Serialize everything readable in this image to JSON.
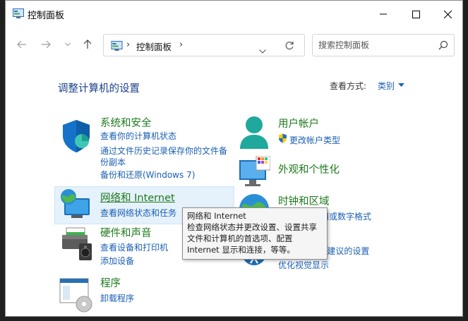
{
  "window": {
    "title": "控制面板"
  },
  "address": {
    "crumb": "控制面板",
    "sep1": "›",
    "sep2": "›"
  },
  "search": {
    "placeholder": "搜索控制面板"
  },
  "main": {
    "heading": "调整计算机的设置",
    "view_by_label": "查看方式:",
    "view_by_value": "类别"
  },
  "categories": {
    "system": {
      "title": "系统和安全",
      "links": [
        "查看你的计算机状态",
        "通过文件历史记录保存你的文件备",
        "份副本",
        "备份和还原(Windows 7)"
      ]
    },
    "network": {
      "title": "网络和 Internet",
      "links": [
        "查看网络状态和任务"
      ]
    },
    "hardware": {
      "title": "硬件和声音",
      "links": [
        "查看设备和打印机",
        "添加设备"
      ]
    },
    "programs": {
      "title": "程序",
      "links": [
        "卸载程序"
      ]
    },
    "user": {
      "title": "用户帐户",
      "links": [
        "更改帐户类型"
      ]
    },
    "appearance": {
      "title": "外观和个性化"
    },
    "clock": {
      "title": "时钟和区域",
      "links": [
        "…日期、时间或数字格式"
      ]
    },
    "ease": {
      "links": [
        "…Windows 建议的设置",
        "优化视觉显示"
      ]
    }
  },
  "tooltip": {
    "lines": [
      "网络和 Internet",
      "检查网络状态并更改设置、设置共享",
      "文件和计算机的首选项、配置",
      "Internet 显示和连接，等等。"
    ]
  },
  "colors": {
    "link": "#1a5fb4",
    "category_title": "#1e7a1e",
    "heading": "#1a3f8c",
    "hover": "#e5f1fb"
  }
}
